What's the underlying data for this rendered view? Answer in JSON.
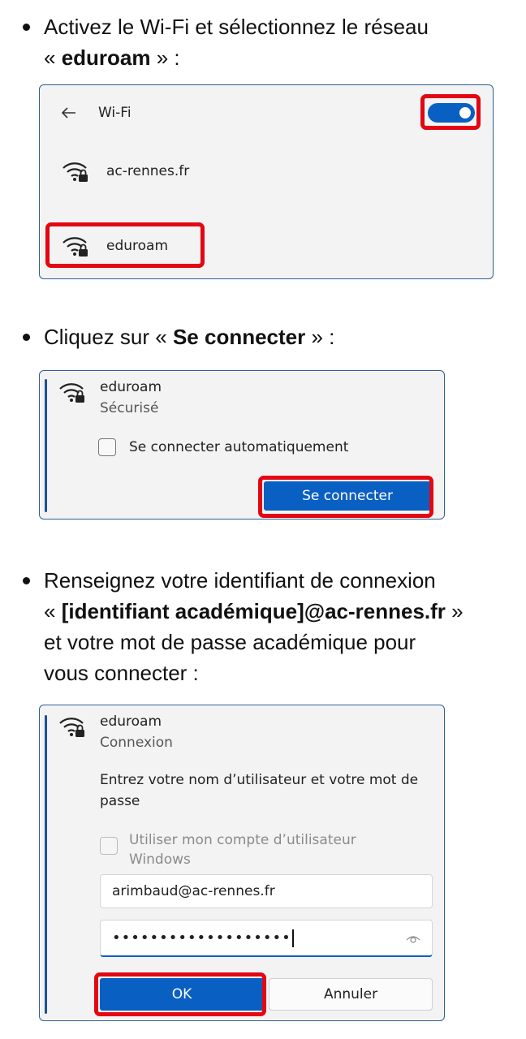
{
  "step1": {
    "text_before": "Activez le Wi-Fi et sélectionnez le réseau",
    "quote_open": "« ",
    "bold": "eduroam",
    "quote_close": " » :"
  },
  "panel1": {
    "title": "Wi-Fi",
    "back_icon": "arrow-left-icon",
    "toggle_state": "on",
    "networks": [
      {
        "name": "ac-rennes.fr",
        "icon": "wifi-secured-icon"
      },
      {
        "name": "eduroam",
        "icon": "wifi-secured-icon"
      }
    ]
  },
  "step2": {
    "text_before": "Cliquez sur ",
    "quote_open": "« ",
    "bold": "Se connecter",
    "quote_close": " » :"
  },
  "panel2": {
    "network_name": "eduroam",
    "status": "Sécurisé",
    "auto_connect_label": "Se connecter automatiquement",
    "connect_button": "Se connecter"
  },
  "step3": {
    "line1": "Renseignez votre identifiant de connexion",
    "quote_open": "« ",
    "bold": "[identifiant académique]@ac-rennes.fr",
    "quote_close": " »",
    "line3": "et votre mot de passe académique pour",
    "line4": "vous connecter :"
  },
  "panel3": {
    "network_name": "eduroam",
    "status": "Connexion",
    "prompt_line1": "Entrez votre nom d’utilisateur et votre mot de",
    "prompt_line2": "passe",
    "use_windows_line1": "Utiliser mon compte d’utilisateur",
    "use_windows_line2": "Windows",
    "username_value": "arimbaud@ac-rennes.fr",
    "password_value": "•••••••••••••••••••",
    "reveal_icon": "eye-icon",
    "ok_button": "OK",
    "cancel_button": "Annuler"
  },
  "colors": {
    "accent_blue": "#0a5fc2",
    "highlight_red": "#e30613",
    "panel_border": "#2f5f8f"
  }
}
